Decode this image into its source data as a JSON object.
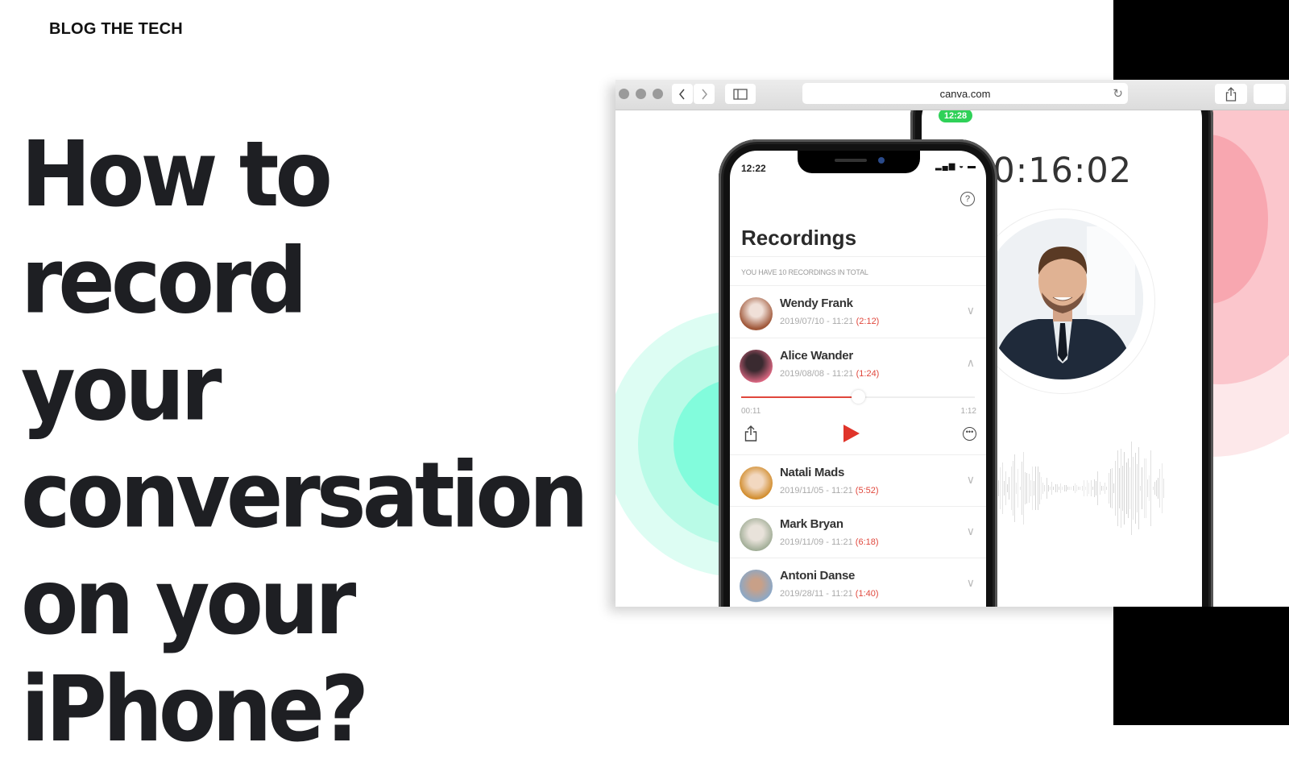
{
  "brand": "BLOG THE TECH",
  "headline_lines": [
    "How to record",
    "your",
    "conversation",
    "on your",
    "iPhone?"
  ],
  "browser": {
    "url": "canva.com",
    "back_icon": "chevron-left-icon",
    "forward_icon": "chevron-right-icon",
    "sidebar_icon": "sidebar-icon",
    "reload_icon": "reload-icon",
    "share_icon": "share-icon"
  },
  "back_phone": {
    "call_badge": "12:28",
    "timer": "00:16:02",
    "accent": "#2fd158"
  },
  "front_phone": {
    "status_time": "12:22",
    "title": "Recordings",
    "count_text": "YOU HAVE 10 RECORDINGS IN TOTAL",
    "help_icon": "help-icon",
    "recordings": [
      {
        "name": "Wendy Frank",
        "date": "2019/07/10 - 11:21",
        "duration": "(2:12)",
        "expanded": false
      },
      {
        "name": "Alice Wander",
        "date": "2019/08/08 - 11:21",
        "duration": "(1:24)",
        "expanded": true
      },
      {
        "name": "Natali Mads",
        "date": "2019/11/05 - 11:21",
        "duration": "(5:52)",
        "expanded": false
      },
      {
        "name": "Mark Bryan",
        "date": "2019/11/09 - 11:21",
        "duration": "(6:18)",
        "expanded": false
      },
      {
        "name": "Antoni Danse",
        "date": "2019/28/11 - 11:21",
        "duration": "(1:40)",
        "expanded": false
      }
    ],
    "player": {
      "elapsed": "00:11",
      "total": "1:12",
      "progress": 0.5,
      "accent": "#e0473c"
    }
  }
}
